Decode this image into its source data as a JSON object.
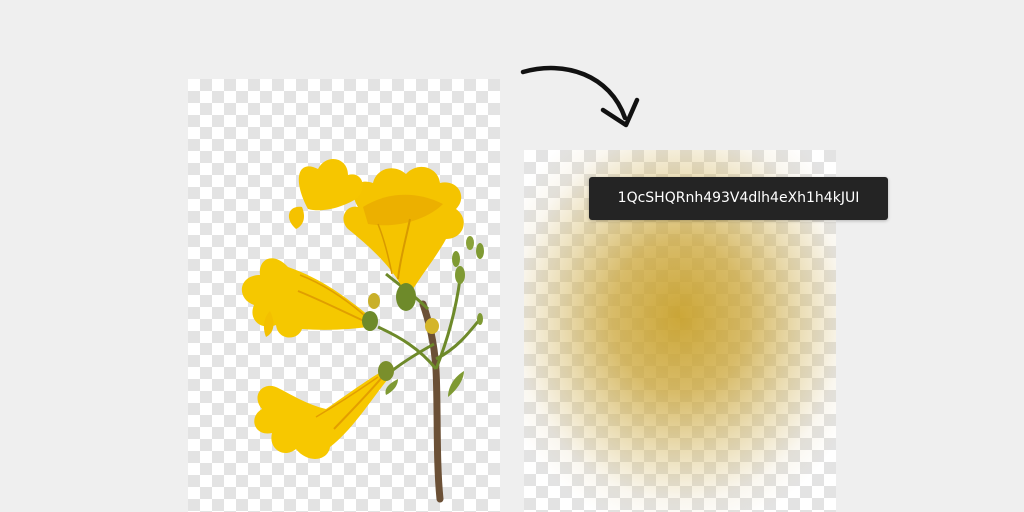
{
  "tooltip": {
    "id_text": "1QcSHQRnh493V4dlh4eXh1h4kJUI"
  },
  "icons": {
    "arrow": "curved-arrow-icon"
  },
  "colors": {
    "background": "#efefef",
    "flower_yellow": "#f2c000",
    "stem_green": "#6e8a2a",
    "tooltip_bg": "#242424"
  }
}
